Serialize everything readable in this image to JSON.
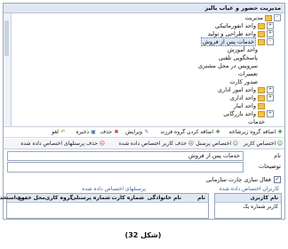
{
  "tree": {
    "header": "مدیریت حضور و غیاب بالیز",
    "nodes": [
      {
        "label": "مدیریت",
        "toggle": "-"
      },
      {
        "label": "واحد انفورماتیکی",
        "toggle": "+"
      },
      {
        "label": "واحد طراحی و تولید",
        "toggle": "+"
      },
      {
        "label": "خدمات پس از فروش",
        "toggle": "-",
        "selected": true
      },
      {
        "label": "واحد آموزش",
        "toggle": ""
      },
      {
        "label": "پاسخگویی تلفنی",
        "toggle": ""
      },
      {
        "label": "سرویس در محل مشتری",
        "toggle": ""
      },
      {
        "label": "تعمیرات",
        "toggle": ""
      },
      {
        "label": "صدور کارت",
        "toggle": ""
      },
      {
        "label": "واحد امور اداری",
        "toggle": "+"
      },
      {
        "label": "واحد اداری",
        "toggle": "+"
      },
      {
        "label": "واحد انبار",
        "toggle": ""
      },
      {
        "label": "واحد بازرگانی",
        "toggle": "+"
      },
      {
        "label": "خدمات",
        "toggle": ""
      }
    ]
  },
  "toolbar": {
    "add_group": "اضافه گروه زیرشاخه",
    "add_group_root": "اضافه کردن گروه فرزند",
    "edit": "ویرایش",
    "delete": "حذف",
    "save": "ذخیره",
    "cancel": "لغو"
  },
  "tabs": {
    "assign_special": "اختصاص کاربر",
    "assign_personnel": "اختصاص پرسنل",
    "remove_user": "حذف کاربر اختصاص داده شده",
    "remove_personnel": "حذف پرسنلهای اختصاص داده شده"
  },
  "form": {
    "name_label": "نام",
    "name_value": "خدمات پس از فروش",
    "desc_label": "توضیحات",
    "desc_value": "",
    "org_chart_label": "فعال سازی چارت سازمانی",
    "org_chart_checked": true
  },
  "users_grid": {
    "caption": "کاربران اختصاص داده شده",
    "header": "نام کاربری",
    "rows": [
      "کاربر شماره یک"
    ]
  },
  "personnel_grid": {
    "caption": "پرسنلهای اختصاص داده شده",
    "headers": [
      "نام",
      "نام خانوادگی",
      "شماره کارت",
      "شماره پرسنلی",
      "گروه کاری",
      "محل خدمت",
      "نوع استخدام"
    ]
  },
  "figure_caption": "(شکل 32)"
}
